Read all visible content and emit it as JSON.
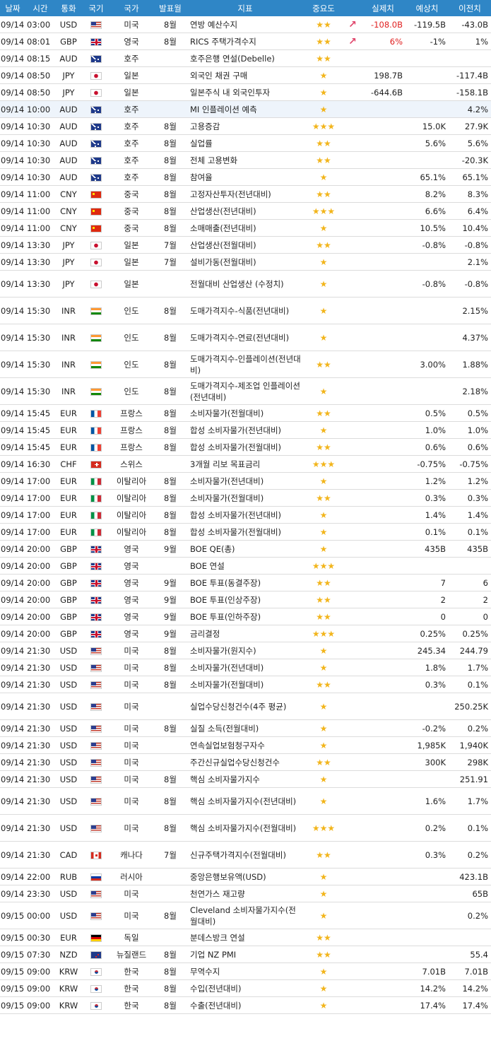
{
  "headers": {
    "date": "날짜",
    "time": "시간",
    "currency": "통화",
    "nation": "국기",
    "country": "국가",
    "period": "발표월",
    "indicator": "지표",
    "importance": "중요도",
    "actual": "실제치",
    "forecast": "예상치",
    "previous": "이전치"
  },
  "colors": {
    "header_bg": "#2f86c6",
    "star": "#f2b51c",
    "negative": "#e02020",
    "arrow": "#e0446a"
  },
  "rows": [
    {
      "date": "09/14",
      "time": "03:00",
      "currency": "USD",
      "flag": "us",
      "country": "미국",
      "period": "8월",
      "name": "연방 예산수지",
      "stars": "★★",
      "arrow": "↗",
      "actual": "-108.0B",
      "actual_neg": true,
      "forecast": "-119.5B",
      "previous": "-43.0B"
    },
    {
      "date": "09/14",
      "time": "08:01",
      "currency": "GBP",
      "flag": "gb",
      "country": "영국",
      "period": "8월",
      "name": "RICS 주택가격수지",
      "stars": "★★",
      "arrow": "↗",
      "actual": "6%",
      "actual_neg": true,
      "forecast": "-1%",
      "previous": "1%"
    },
    {
      "date": "09/14",
      "time": "08:15",
      "currency": "AUD",
      "flag": "au",
      "country": "호주",
      "period": "",
      "name": "호주은행 연설(Debelle)",
      "stars": "★★",
      "arrow": "",
      "actual": "",
      "forecast": "",
      "previous": ""
    },
    {
      "date": "09/14",
      "time": "08:50",
      "currency": "JPY",
      "flag": "jp",
      "country": "일본",
      "period": "",
      "name": "외국인 채권 구매",
      "stars": "★",
      "arrow": "",
      "actual": "198.7B",
      "forecast": "",
      "previous": "-117.4B"
    },
    {
      "date": "09/14",
      "time": "08:50",
      "currency": "JPY",
      "flag": "jp",
      "country": "일본",
      "period": "",
      "name": "일본주식 내 외국인투자",
      "stars": "★",
      "arrow": "",
      "actual": "-644.6B",
      "forecast": "",
      "previous": "-158.1B"
    },
    {
      "date": "09/14",
      "time": "10:00",
      "currency": "AUD",
      "flag": "au",
      "country": "호주",
      "period": "",
      "name": "MI 인플레이션 예측",
      "stars": "★",
      "arrow": "",
      "actual": "",
      "forecast": "",
      "previous": "4.2%",
      "highlight": true
    },
    {
      "date": "09/14",
      "time": "10:30",
      "currency": "AUD",
      "flag": "au",
      "country": "호주",
      "period": "8월",
      "name": "고용증감",
      "stars": "★★★",
      "arrow": "",
      "actual": "",
      "forecast": "15.0K",
      "previous": "27.9K"
    },
    {
      "date": "09/14",
      "time": "10:30",
      "currency": "AUD",
      "flag": "au",
      "country": "호주",
      "period": "8월",
      "name": "실업률",
      "stars": "★★",
      "arrow": "",
      "actual": "",
      "forecast": "5.6%",
      "previous": "5.6%"
    },
    {
      "date": "09/14",
      "time": "10:30",
      "currency": "AUD",
      "flag": "au",
      "country": "호주",
      "period": "8월",
      "name": "전체 고용변화",
      "stars": "★★",
      "arrow": "",
      "actual": "",
      "forecast": "",
      "previous": "-20.3K"
    },
    {
      "date": "09/14",
      "time": "10:30",
      "currency": "AUD",
      "flag": "au",
      "country": "호주",
      "period": "8월",
      "name": "참여율",
      "stars": "★",
      "arrow": "",
      "actual": "",
      "forecast": "65.1%",
      "previous": "65.1%"
    },
    {
      "date": "09/14",
      "time": "11:00",
      "currency": "CNY",
      "flag": "cn",
      "country": "중국",
      "period": "8월",
      "name": "고정자산투자(전년대비)",
      "stars": "★★",
      "arrow": "",
      "actual": "",
      "forecast": "8.2%",
      "previous": "8.3%"
    },
    {
      "date": "09/14",
      "time": "11:00",
      "currency": "CNY",
      "flag": "cn",
      "country": "중국",
      "period": "8월",
      "name": "산업생산(전년대비)",
      "stars": "★★★",
      "arrow": "",
      "actual": "",
      "forecast": "6.6%",
      "previous": "6.4%"
    },
    {
      "date": "09/14",
      "time": "11:00",
      "currency": "CNY",
      "flag": "cn",
      "country": "중국",
      "period": "8월",
      "name": "소매매출(전년대비)",
      "stars": "★",
      "arrow": "",
      "actual": "",
      "forecast": "10.5%",
      "previous": "10.4%"
    },
    {
      "date": "09/14",
      "time": "13:30",
      "currency": "JPY",
      "flag": "jp",
      "country": "일본",
      "period": "7월",
      "name": "산업생산(전월대비)",
      "stars": "★★",
      "arrow": "",
      "actual": "",
      "forecast": "-0.8%",
      "previous": "-0.8%"
    },
    {
      "date": "09/14",
      "time": "13:30",
      "currency": "JPY",
      "flag": "jp",
      "country": "일본",
      "period": "7월",
      "name": "설비가동(전월대비)",
      "stars": "★",
      "arrow": "",
      "actual": "",
      "forecast": "",
      "previous": "2.1%"
    },
    {
      "date": "09/14",
      "time": "13:30",
      "currency": "JPY",
      "flag": "jp",
      "country": "일본",
      "period": "",
      "name": "전월대비 산업생산 (수정치)",
      "stars": "★",
      "arrow": "",
      "actual": "",
      "forecast": "-0.8%",
      "previous": "-0.8%",
      "tall": true
    },
    {
      "date": "09/14",
      "time": "15:30",
      "currency": "INR",
      "flag": "in",
      "country": "인도",
      "period": "8월",
      "name": "도매가격지수-식품(전년대비)",
      "stars": "★",
      "arrow": "",
      "actual": "",
      "forecast": "",
      "previous": "2.15%",
      "tall": true
    },
    {
      "date": "09/14",
      "time": "15:30",
      "currency": "INR",
      "flag": "in",
      "country": "인도",
      "period": "8월",
      "name": "도매가격지수-연료(전년대비)",
      "stars": "★",
      "arrow": "",
      "actual": "",
      "forecast": "",
      "previous": "4.37%",
      "tall": true
    },
    {
      "date": "09/14",
      "time": "15:30",
      "currency": "INR",
      "flag": "in",
      "country": "인도",
      "period": "8월",
      "name": "도매가격지수-인플레이션(전년대비)",
      "stars": "★★",
      "arrow": "",
      "actual": "",
      "forecast": "3.00%",
      "previous": "1.88%",
      "tall": true
    },
    {
      "date": "09/14",
      "time": "15:30",
      "currency": "INR",
      "flag": "in",
      "country": "인도",
      "period": "8월",
      "name": "도매가격지수-제조업 인플레이션(전년대비)",
      "stars": "★",
      "arrow": "",
      "actual": "",
      "forecast": "",
      "previous": "2.18%",
      "tall": true
    },
    {
      "date": "09/14",
      "time": "15:45",
      "currency": "EUR",
      "flag": "fr",
      "country": "프랑스",
      "period": "8월",
      "name": "소비자물가(전월대비)",
      "stars": "★★",
      "arrow": "",
      "actual": "",
      "forecast": "0.5%",
      "previous": "0.5%"
    },
    {
      "date": "09/14",
      "time": "15:45",
      "currency": "EUR",
      "flag": "fr",
      "country": "프랑스",
      "period": "8월",
      "name": "합성 소비자물가(전년대비)",
      "stars": "★",
      "arrow": "",
      "actual": "",
      "forecast": "1.0%",
      "previous": "1.0%"
    },
    {
      "date": "09/14",
      "time": "15:45",
      "currency": "EUR",
      "flag": "fr",
      "country": "프랑스",
      "period": "8월",
      "name": "합성 소비자물가(전월대비)",
      "stars": "★★",
      "arrow": "",
      "actual": "",
      "forecast": "0.6%",
      "previous": "0.6%"
    },
    {
      "date": "09/14",
      "time": "16:30",
      "currency": "CHF",
      "flag": "ch",
      "country": "스위스",
      "period": "",
      "name": "3개월 리보 목표금리",
      "stars": "★★★",
      "arrow": "",
      "actual": "",
      "forecast": "-0.75%",
      "previous": "-0.75%"
    },
    {
      "date": "09/14",
      "time": "17:00",
      "currency": "EUR",
      "flag": "it",
      "country": "이탈리아",
      "period": "8월",
      "name": "소비자물가(전년대비)",
      "stars": "★",
      "arrow": "",
      "actual": "",
      "forecast": "1.2%",
      "previous": "1.2%"
    },
    {
      "date": "09/14",
      "time": "17:00",
      "currency": "EUR",
      "flag": "it",
      "country": "이탈리아",
      "period": "8월",
      "name": "소비자물가(전월대비)",
      "stars": "★★",
      "arrow": "",
      "actual": "",
      "forecast": "0.3%",
      "previous": "0.3%"
    },
    {
      "date": "09/14",
      "time": "17:00",
      "currency": "EUR",
      "flag": "it",
      "country": "이탈리아",
      "period": "8월",
      "name": "합성 소비자물가(전년대비)",
      "stars": "★",
      "arrow": "",
      "actual": "",
      "forecast": "1.4%",
      "previous": "1.4%"
    },
    {
      "date": "09/14",
      "time": "17:00",
      "currency": "EUR",
      "flag": "it",
      "country": "이탈리아",
      "period": "8월",
      "name": "합성 소비자물가(전월대비)",
      "stars": "★",
      "arrow": "",
      "actual": "",
      "forecast": "0.1%",
      "previous": "0.1%"
    },
    {
      "date": "09/14",
      "time": "20:00",
      "currency": "GBP",
      "flag": "gb",
      "country": "영국",
      "period": "9월",
      "name": "BOE QE(총)",
      "stars": "★",
      "arrow": "",
      "actual": "",
      "forecast": "435B",
      "previous": "435B"
    },
    {
      "date": "09/14",
      "time": "20:00",
      "currency": "GBP",
      "flag": "gb",
      "country": "영국",
      "period": "",
      "name": "BOE 연설",
      "stars": "★★★",
      "arrow": "",
      "actual": "",
      "forecast": "",
      "previous": ""
    },
    {
      "date": "09/14",
      "time": "20:00",
      "currency": "GBP",
      "flag": "gb",
      "country": "영국",
      "period": "9월",
      "name": "BOE 투표(동결주장)",
      "stars": "★★",
      "arrow": "",
      "actual": "",
      "forecast": "7",
      "previous": "6"
    },
    {
      "date": "09/14",
      "time": "20:00",
      "currency": "GBP",
      "flag": "gb",
      "country": "영국",
      "period": "9월",
      "name": "BOE 투표(인상주장)",
      "stars": "★★",
      "arrow": "",
      "actual": "",
      "forecast": "2",
      "previous": "2"
    },
    {
      "date": "09/14",
      "time": "20:00",
      "currency": "GBP",
      "flag": "gb",
      "country": "영국",
      "period": "9월",
      "name": "BOE 투표(인하주장)",
      "stars": "★★",
      "arrow": "",
      "actual": "",
      "forecast": "0",
      "previous": "0"
    },
    {
      "date": "09/14",
      "time": "20:00",
      "currency": "GBP",
      "flag": "gb",
      "country": "영국",
      "period": "9월",
      "name": "금리결정",
      "stars": "★★★",
      "arrow": "",
      "actual": "",
      "forecast": "0.25%",
      "previous": "0.25%"
    },
    {
      "date": "09/14",
      "time": "21:30",
      "currency": "USD",
      "flag": "us",
      "country": "미국",
      "period": "8월",
      "name": "소비자물가(원지수)",
      "stars": "★",
      "arrow": "",
      "actual": "",
      "forecast": "245.34",
      "previous": "244.79"
    },
    {
      "date": "09/14",
      "time": "21:30",
      "currency": "USD",
      "flag": "us",
      "country": "미국",
      "period": "8월",
      "name": "소비자물가(전년대비)",
      "stars": "★",
      "arrow": "",
      "actual": "",
      "forecast": "1.8%",
      "previous": "1.7%"
    },
    {
      "date": "09/14",
      "time": "21:30",
      "currency": "USD",
      "flag": "us",
      "country": "미국",
      "period": "8월",
      "name": "소비자물가(전월대비)",
      "stars": "★★",
      "arrow": "",
      "actual": "",
      "forecast": "0.3%",
      "previous": "0.1%"
    },
    {
      "date": "09/14",
      "time": "21:30",
      "currency": "USD",
      "flag": "us",
      "country": "미국",
      "period": "",
      "name": "실업수당신청건수(4주 평균)",
      "stars": "★",
      "arrow": "",
      "actual": "",
      "forecast": "",
      "previous": "250.25K",
      "tall": true
    },
    {
      "date": "09/14",
      "time": "21:30",
      "currency": "USD",
      "flag": "us",
      "country": "미국",
      "period": "8월",
      "name": "실질 소득(전월대비)",
      "stars": "★",
      "arrow": "",
      "actual": "",
      "forecast": "-0.2%",
      "previous": "0.2%"
    },
    {
      "date": "09/14",
      "time": "21:30",
      "currency": "USD",
      "flag": "us",
      "country": "미국",
      "period": "",
      "name": "연속실업보험청구자수",
      "stars": "★",
      "arrow": "",
      "actual": "",
      "forecast": "1,985K",
      "previous": "1,940K"
    },
    {
      "date": "09/14",
      "time": "21:30",
      "currency": "USD",
      "flag": "us",
      "country": "미국",
      "period": "",
      "name": "주간신규실업수당신청건수",
      "stars": "★★",
      "arrow": "",
      "actual": "",
      "forecast": "300K",
      "previous": "298K"
    },
    {
      "date": "09/14",
      "time": "21:30",
      "currency": "USD",
      "flag": "us",
      "country": "미국",
      "period": "8월",
      "name": "핵심 소비자물가지수",
      "stars": "★",
      "arrow": "",
      "actual": "",
      "forecast": "",
      "previous": "251.91"
    },
    {
      "date": "09/14",
      "time": "21:30",
      "currency": "USD",
      "flag": "us",
      "country": "미국",
      "period": "8월",
      "name": "핵심 소비자물가지수(전년대비)",
      "stars": "★",
      "arrow": "",
      "actual": "",
      "forecast": "1.6%",
      "previous": "1.7%",
      "tall": true
    },
    {
      "date": "09/14",
      "time": "21:30",
      "currency": "USD",
      "flag": "us",
      "country": "미국",
      "period": "8월",
      "name": "핵심 소비자물가지수(전월대비)",
      "stars": "★★★",
      "arrow": "",
      "actual": "",
      "forecast": "0.2%",
      "previous": "0.1%",
      "tall": true
    },
    {
      "date": "09/14",
      "time": "21:30",
      "currency": "CAD",
      "flag": "ca",
      "country": "캐나다",
      "period": "7월",
      "name": "신규주택가격지수(전월대비)",
      "stars": "★★",
      "arrow": "",
      "actual": "",
      "forecast": "0.3%",
      "previous": "0.2%",
      "tall": true
    },
    {
      "date": "09/14",
      "time": "22:00",
      "currency": "RUB",
      "flag": "ru",
      "country": "러시아",
      "period": "",
      "name": "중앙은행보유액(USD)",
      "stars": "★",
      "arrow": "",
      "actual": "",
      "forecast": "",
      "previous": "423.1B"
    },
    {
      "date": "09/14",
      "time": "23:30",
      "currency": "USD",
      "flag": "us",
      "country": "미국",
      "period": "",
      "name": "천연가스 재고량",
      "stars": "★",
      "arrow": "",
      "actual": "",
      "forecast": "",
      "previous": "65B"
    },
    {
      "date": "09/15",
      "time": "00:00",
      "currency": "USD",
      "flag": "us",
      "country": "미국",
      "period": "8월",
      "name": "Cleveland 소비자물가지수(전월대비)",
      "stars": "★",
      "arrow": "",
      "actual": "",
      "forecast": "",
      "previous": "0.2%",
      "tall": true
    },
    {
      "date": "09/15",
      "time": "00:30",
      "currency": "EUR",
      "flag": "de",
      "country": "독일",
      "period": "",
      "name": "분데스방크 연설",
      "stars": "★★",
      "arrow": "",
      "actual": "",
      "forecast": "",
      "previous": ""
    },
    {
      "date": "09/15",
      "time": "07:30",
      "currency": "NZD",
      "flag": "nz",
      "country": "뉴질랜드",
      "period": "8월",
      "name": "기업 NZ PMI",
      "stars": "★★",
      "arrow": "",
      "actual": "",
      "forecast": "",
      "previous": "55.4"
    },
    {
      "date": "09/15",
      "time": "09:00",
      "currency": "KRW",
      "flag": "kr",
      "country": "한국",
      "period": "8월",
      "name": "무역수지",
      "stars": "★",
      "arrow": "",
      "actual": "",
      "forecast": "7.01B",
      "previous": "7.01B"
    },
    {
      "date": "09/15",
      "time": "09:00",
      "currency": "KRW",
      "flag": "kr",
      "country": "한국",
      "period": "8월",
      "name": "수입(전년대비)",
      "stars": "★",
      "arrow": "",
      "actual": "",
      "forecast": "14.2%",
      "previous": "14.2%"
    },
    {
      "date": "09/15",
      "time": "09:00",
      "currency": "KRW",
      "flag": "kr",
      "country": "한국",
      "period": "8월",
      "name": "수출(전년대비)",
      "stars": "★",
      "arrow": "",
      "actual": "",
      "forecast": "17.4%",
      "previous": "17.4%"
    }
  ]
}
